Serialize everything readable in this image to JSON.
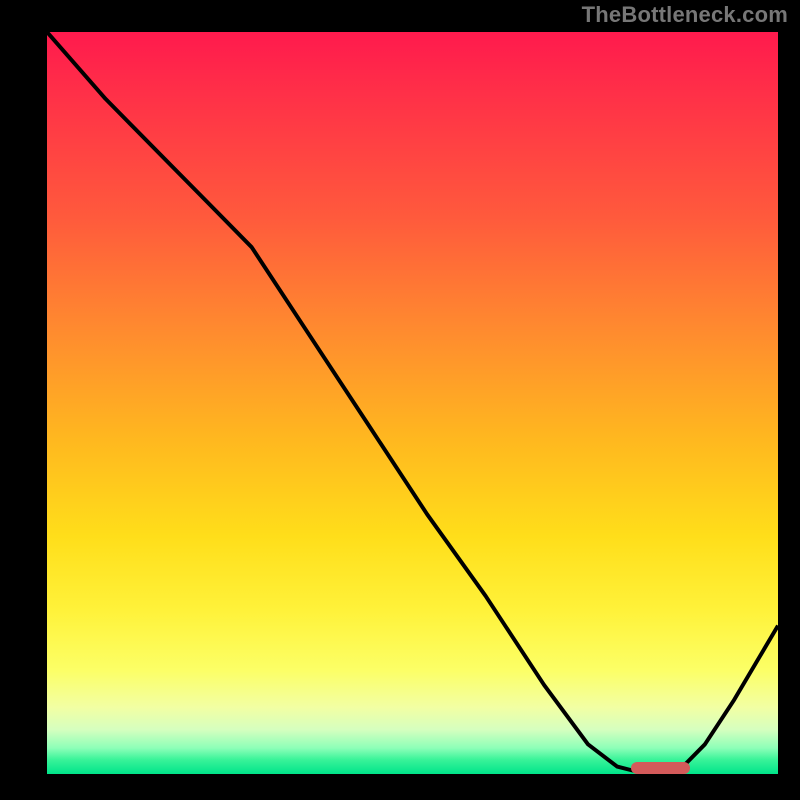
{
  "watermark": "TheBottleneck.com",
  "chart_data": {
    "type": "line",
    "title": "",
    "xlabel": "",
    "ylabel": "",
    "xlim": [
      0,
      100
    ],
    "ylim": [
      0,
      100
    ],
    "grid": false,
    "legend": false,
    "series": [
      {
        "name": "curve",
        "x": [
          0,
          8,
          16,
          22,
          28,
          36,
          44,
          52,
          60,
          68,
          74,
          78,
          82,
          86,
          90,
          94,
          100
        ],
        "y": [
          100,
          91,
          83,
          77,
          71,
          59,
          47,
          35,
          24,
          12,
          4,
          1,
          0,
          0,
          4,
          10,
          20
        ]
      }
    ],
    "optimal_marker": {
      "x_start": 79,
      "x_end": 87,
      "y": 0
    },
    "gradient_stops": [
      {
        "pos": 0,
        "color": "#ff1a4d"
      },
      {
        "pos": 25,
        "color": "#ff5a3c"
      },
      {
        "pos": 55,
        "color": "#ffb81f"
      },
      {
        "pos": 78,
        "color": "#fff23a"
      },
      {
        "pos": 94,
        "color": "#d6ffbf"
      },
      {
        "pos": 100,
        "color": "#00e48a"
      }
    ]
  }
}
